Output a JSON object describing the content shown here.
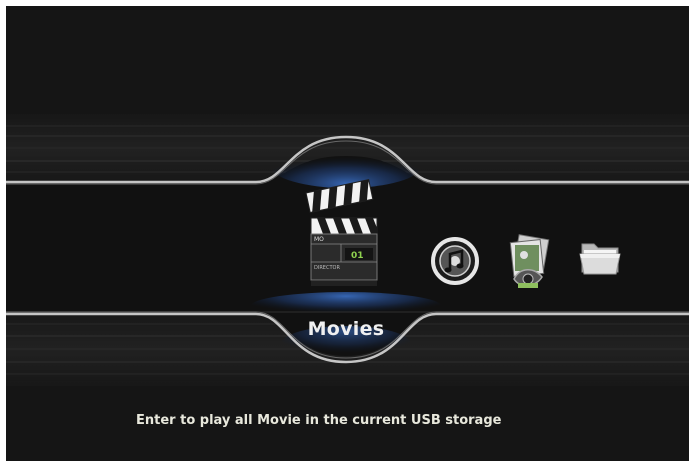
{
  "menu": {
    "items": [
      {
        "id": "movies",
        "label": "Movies",
        "icon": "clapperboard-icon",
        "selected": true
      },
      {
        "id": "music",
        "icon": "music-disc-icon",
        "selected": false
      },
      {
        "id": "photo",
        "icon": "photo-stack-icon",
        "selected": false
      },
      {
        "id": "folder",
        "icon": "folder-icon",
        "selected": false
      }
    ],
    "selected_label": "Movies",
    "clapper": {
      "tag": "MO",
      "scene_value": "01",
      "director_label": "DIRECTOR"
    }
  },
  "hint": "Enter to play all Movie in the current USB storage",
  "colors": {
    "background": "#151515",
    "accent_glow": "#2e5aa8",
    "text": "#f0f0f0"
  }
}
